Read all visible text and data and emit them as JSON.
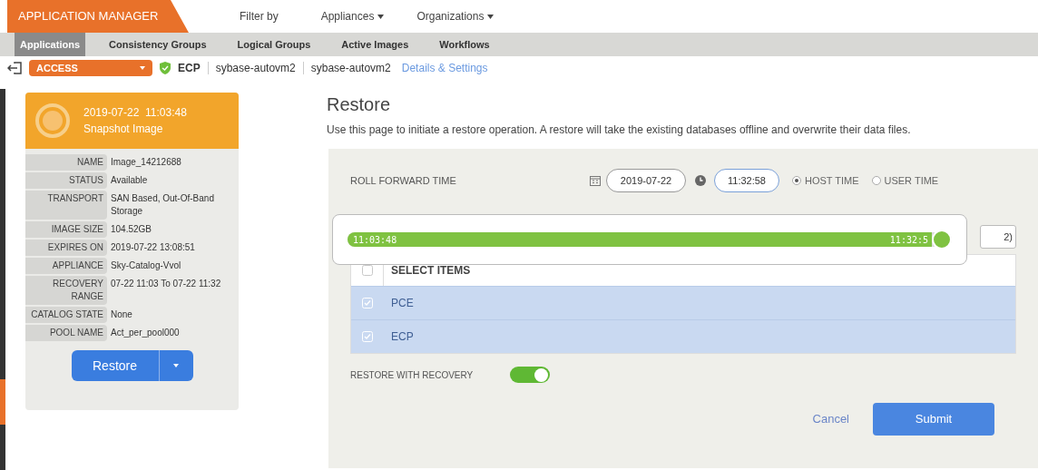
{
  "app_title": "APPLICATION MANAGER",
  "top_menu": [
    {
      "label": "Filter by",
      "dropdown": false
    },
    {
      "label": "Appliances",
      "dropdown": true
    },
    {
      "label": "Organizations",
      "dropdown": true
    }
  ],
  "tabs": [
    {
      "label": "Applications",
      "selected": true
    },
    {
      "label": "Consistency Groups",
      "selected": false
    },
    {
      "label": "Logical Groups",
      "selected": false
    },
    {
      "label": "Active Images",
      "selected": false
    },
    {
      "label": "Workflows",
      "selected": false
    }
  ],
  "breadcrumb": {
    "select": "ACCESS",
    "app": "ECP",
    "host": "sybase-autovm2",
    "db": "sybase-autovm2",
    "link": "Details & Settings"
  },
  "snapshot": {
    "date": "2019-07-22  11:03:48",
    "type": "Snapshot Image",
    "fields": [
      {
        "label": "NAME",
        "value": "Image_14212688"
      },
      {
        "label": "STATUS",
        "value": "Available"
      },
      {
        "label": "TRANSPORT",
        "value": "SAN Based, Out-Of-Band Storage"
      },
      {
        "label": "IMAGE SIZE",
        "value": "104.52GB"
      },
      {
        "label": "EXPIRES ON",
        "value": "2019-07-22 13:08:51"
      },
      {
        "label": "APPLIANCE",
        "value": "Sky-Catalog-Vvol"
      },
      {
        "label": "RECOVERY RANGE",
        "value": "07-22 11:03 To 07-22 11:32"
      },
      {
        "label": "CATALOG STATE",
        "value": "None"
      },
      {
        "label": "POOL NAME",
        "value": "Act_per_pool000"
      }
    ],
    "button": "Restore"
  },
  "restore": {
    "title": "Restore",
    "description": "Use this page to initiate a restore operation. A restore will take the existing databases offline and overwrite their data files.",
    "roll_forward_label": "ROLL FORWARD TIME",
    "date": "2019-07-22",
    "time": "11:32:58",
    "time_modes": [
      {
        "label": "HOST TIME",
        "selected": true
      },
      {
        "label": "USER TIME",
        "selected": false
      }
    ],
    "slider": {
      "start": "11:03:48",
      "end": "11:32:5",
      "level": 1
    },
    "side_button": "2)",
    "table_header": {
      "label": "SELECT ITEMS",
      "checked": false
    },
    "items": [
      {
        "label": "PCE",
        "checked": true,
        "selected": true
      },
      {
        "label": "ECP",
        "checked": true,
        "selected": true
      }
    ],
    "recovery_label": "RESTORE WITH RECOVERY",
    "recovery_on": true,
    "cancel": "Cancel",
    "submit": "Submit"
  }
}
